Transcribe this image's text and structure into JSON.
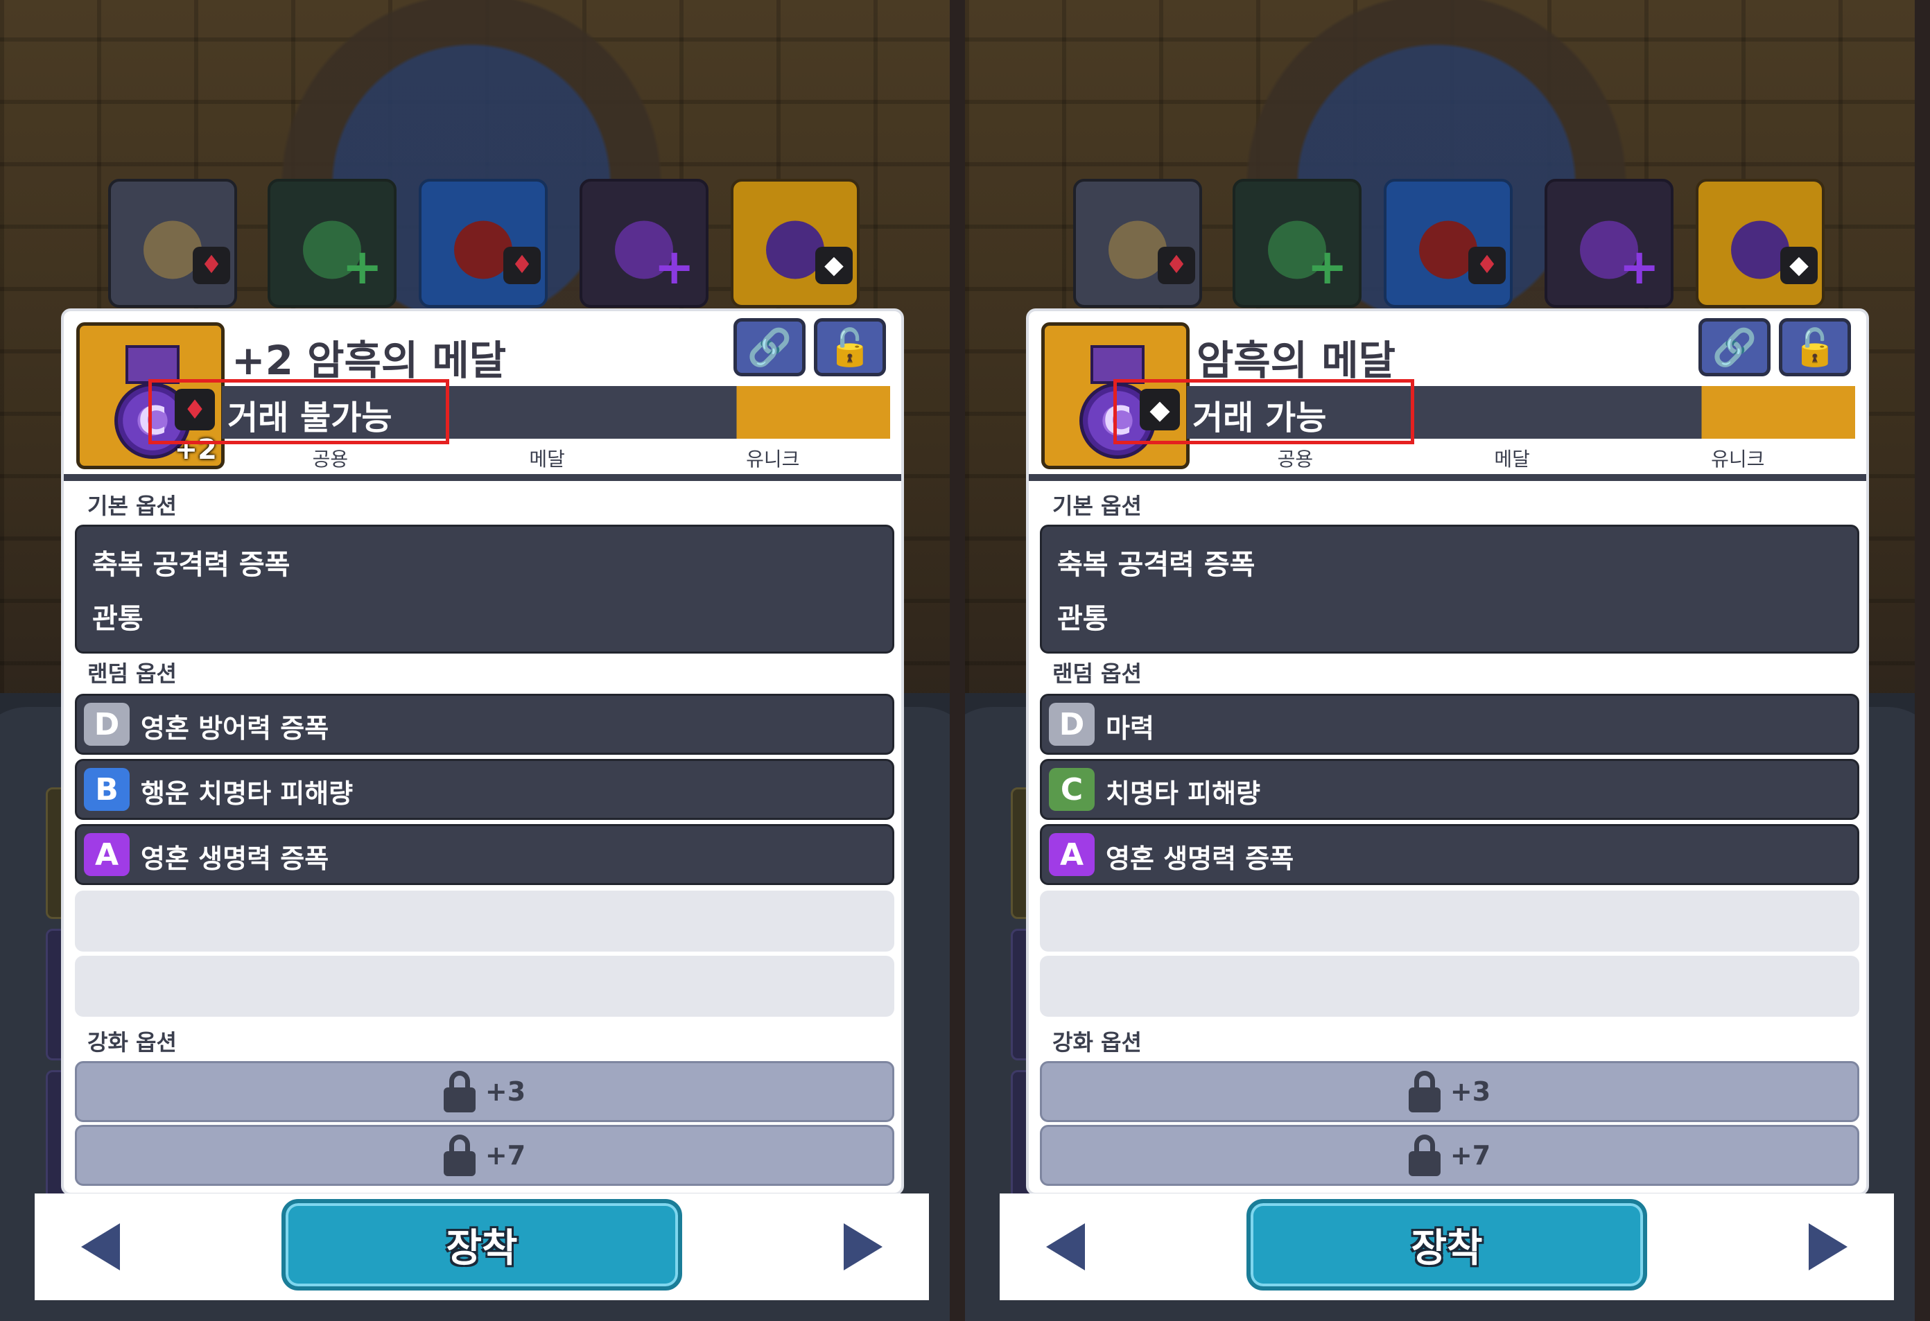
{
  "panels": [
    {
      "item": {
        "title": "+2 암흑의 메달",
        "enhance_level": "+2",
        "icon_letter": "C",
        "trade_status": "거래 불가능",
        "trade_gem": "ruby",
        "tags": [
          "공용",
          "메달",
          "유니크"
        ]
      },
      "sections": {
        "basic_label": "기본 옵션",
        "random_label": "랜덤 옵션",
        "enhance_label": "강화 옵션"
      },
      "basic_options": [
        "축복 공격력 증폭",
        "관통"
      ],
      "random_options": [
        {
          "grade": "D",
          "text": "영혼 방어력 증폭"
        },
        {
          "grade": "B",
          "text": "행운 치명타 피해량"
        },
        {
          "grade": "A",
          "text": "영혼 생명력 증폭"
        }
      ],
      "enhance_options": [
        "+3",
        "+7"
      ],
      "equip_label": "장착"
    },
    {
      "item": {
        "title": "암흑의 메달",
        "enhance_level": "",
        "icon_letter": "C",
        "trade_status": "거래 가능",
        "trade_gem": "diamond",
        "tags": [
          "공용",
          "메달",
          "유니크"
        ]
      },
      "sections": {
        "basic_label": "기본 옵션",
        "random_label": "랜덤 옵션",
        "enhance_label": "강화 옵션"
      },
      "basic_options": [
        "축복 공격력 증폭",
        "관통"
      ],
      "random_options": [
        {
          "grade": "D",
          "text": "마력"
        },
        {
          "grade": "C",
          "text": "치명타 피해량"
        },
        {
          "grade": "A",
          "text": "영혼 생명력 증폭"
        }
      ],
      "enhance_options": [
        "+3",
        "+7"
      ],
      "equip_label": "장착"
    }
  ],
  "icons": {
    "link": "🔗",
    "unlock": "🔓",
    "ruby": "♦",
    "diamond": "◆"
  },
  "colors": {
    "highlight": "#e52020",
    "equip_button": "#21a0c2",
    "grade_D": "#a8acba",
    "grade_C": "#5a9a4c",
    "grade_B": "#3a7be0",
    "grade_A": "#a03ce6"
  }
}
